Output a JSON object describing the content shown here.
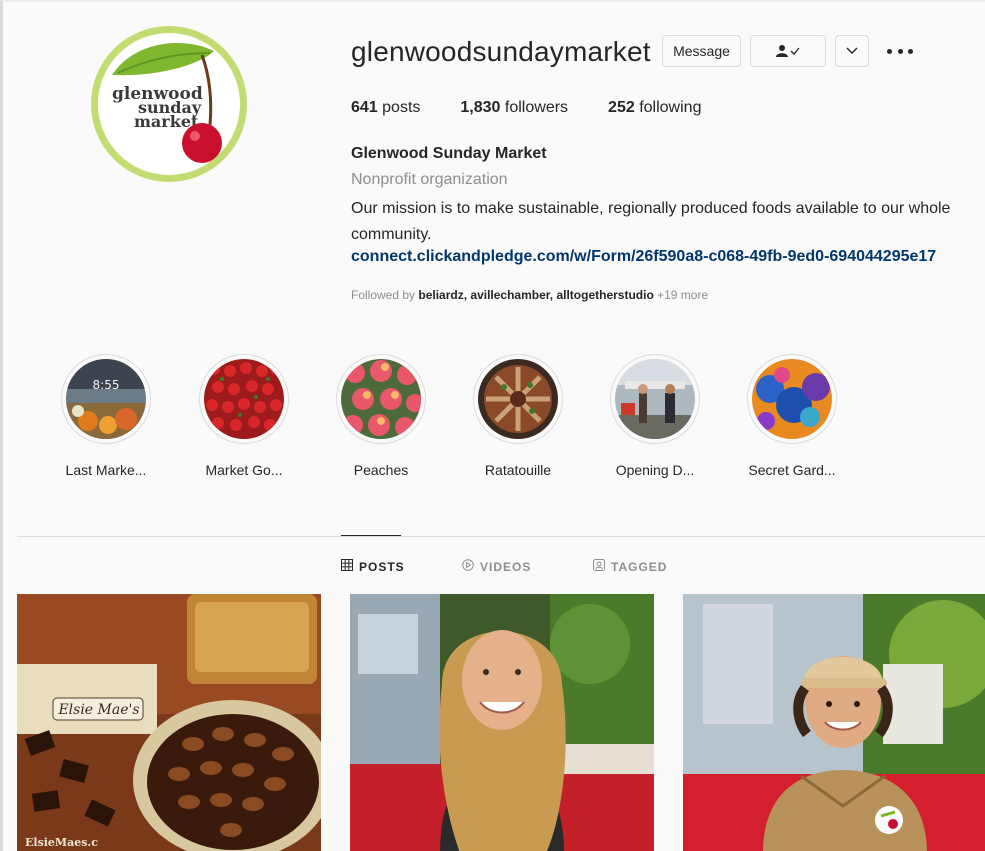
{
  "profile": {
    "username": "glenwoodsundaymarket",
    "posts_count": "641",
    "posts_label": "posts",
    "followers_count": "1,830",
    "followers_label": "followers",
    "following_count": "252",
    "following_label": "following",
    "full_name": "Glenwood Sunday Market",
    "category": "Nonprofit organization",
    "bio": "Our mission is to make sustainable, regionally produced foods available to our whole community.",
    "link": "connect.clickandpledge.com/w/Form/26f590a8-c068-49fb-9ed0-694044295e17",
    "followed_by_prefix": "Followed by ",
    "followed_by_names": "beliardz, avillechamber, alltogetherstudio",
    "followed_by_more": " +19 more",
    "logo_lines": [
      "glenwood",
      "sunday",
      "market"
    ]
  },
  "actions": {
    "message_label": "Message",
    "follow_icon": "person-check-icon",
    "chevron_icon": "chevron-down-icon",
    "more_icon": "more-horizontal-icon"
  },
  "highlights": [
    {
      "label": "Last Marke...",
      "overlay": "8:55"
    },
    {
      "label": "Market Go..."
    },
    {
      "label": "Peaches"
    },
    {
      "label": "Ratatouille"
    },
    {
      "label": "Opening D..."
    },
    {
      "label": "Secret Gard..."
    }
  ],
  "tabs": [
    {
      "label": "POSTS",
      "icon": "grid-icon",
      "active": true
    },
    {
      "label": "VIDEOS",
      "icon": "play-icon",
      "active": false
    },
    {
      "label": "TAGGED",
      "icon": "tag-icon",
      "active": false
    }
  ],
  "posts": [
    {
      "image": "pecan-pie-photo",
      "sign_text": "Elsie Mae's",
      "watermark": "ElsieMaes.c"
    },
    {
      "image": "smiling-woman-photo"
    },
    {
      "image": "man-in-cap-photo"
    }
  ],
  "colors": {
    "link": "#00376b",
    "muted": "#8e8e8e",
    "logo_ring": "#c3dc72",
    "cherry": "#c8102e"
  }
}
